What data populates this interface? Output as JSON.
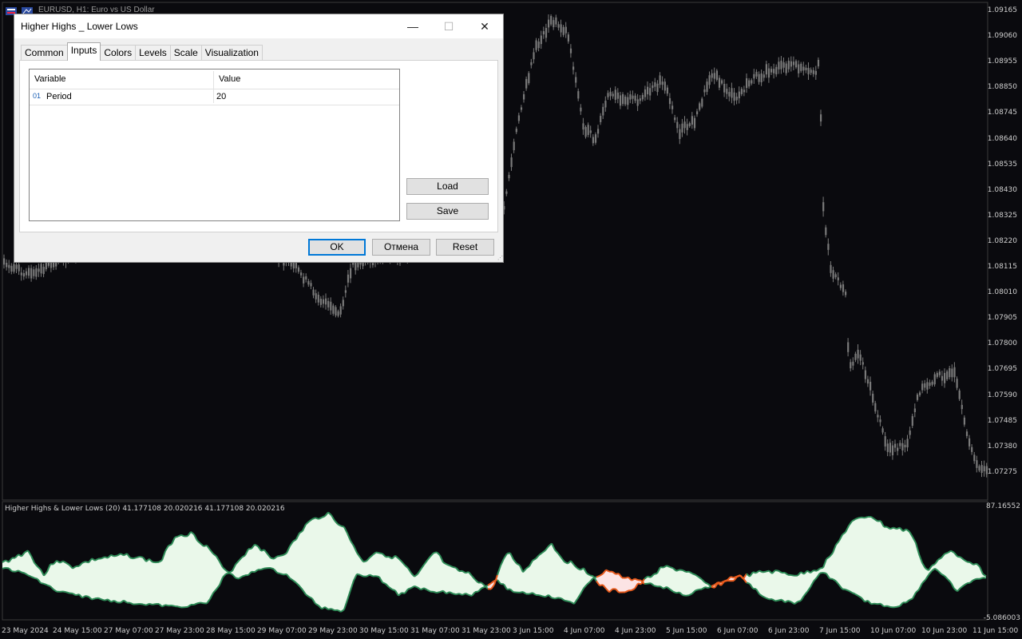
{
  "chart": {
    "title": "EURUSD, H1:  Euro vs US Dollar",
    "price_labels": [
      "1.09165",
      "1.09060",
      "1.08955",
      "1.08850",
      "1.08745",
      "1.08640",
      "1.08535",
      "1.08430",
      "1.08325",
      "1.08220",
      "1.08115",
      "1.08010",
      "1.07905",
      "1.07800",
      "1.07695",
      "1.07590",
      "1.07485",
      "1.07380",
      "1.07275"
    ],
    "time_labels": [
      "23 May 2024",
      "24 May 15:00",
      "27 May 07:00",
      "27 May 23:00",
      "28 May 15:00",
      "29 May 07:00",
      "29 May 23:00",
      "30 May 15:00",
      "31 May 07:00",
      "31 May 23:00",
      "3 Jun 15:00",
      "4 Jun 07:00",
      "4 Jun 23:00",
      "5 Jun 15:00",
      "6 Jun 07:00",
      "6 Jun 23:00",
      "7 Jun 15:00",
      "10 Jun 07:00",
      "10 Jun 23:00",
      "11 Jun 15:00"
    ],
    "candle_color": "#7a7a7a",
    "background": "#0a0a0e"
  },
  "indicator": {
    "header": "Higher Highs & Lower Lows (20) 41.177108 20.020216 41.177108 20.020216",
    "scale_max": "87.16552",
    "scale_min": "-5.086003",
    "up_color": "#2e8b57",
    "down_color": "#e85a1c",
    "up_fill": "#eaf8ea",
    "down_fill": "#fce4e4"
  },
  "dialog": {
    "title": "Higher Highs _ Lower Lows",
    "tabs": [
      "Common",
      "Inputs",
      "Colors",
      "Levels",
      "Scale",
      "Visualization"
    ],
    "active_tab": "Inputs",
    "columns": [
      "Variable",
      "Value"
    ],
    "rows": [
      {
        "icon": "01",
        "variable": "Period",
        "value": "20"
      }
    ],
    "buttons": {
      "load": "Load",
      "save": "Save",
      "ok": "OK",
      "cancel": "Отмена",
      "reset": "Reset"
    },
    "minimize": "—",
    "maximize": "☐",
    "close": "✕"
  }
}
